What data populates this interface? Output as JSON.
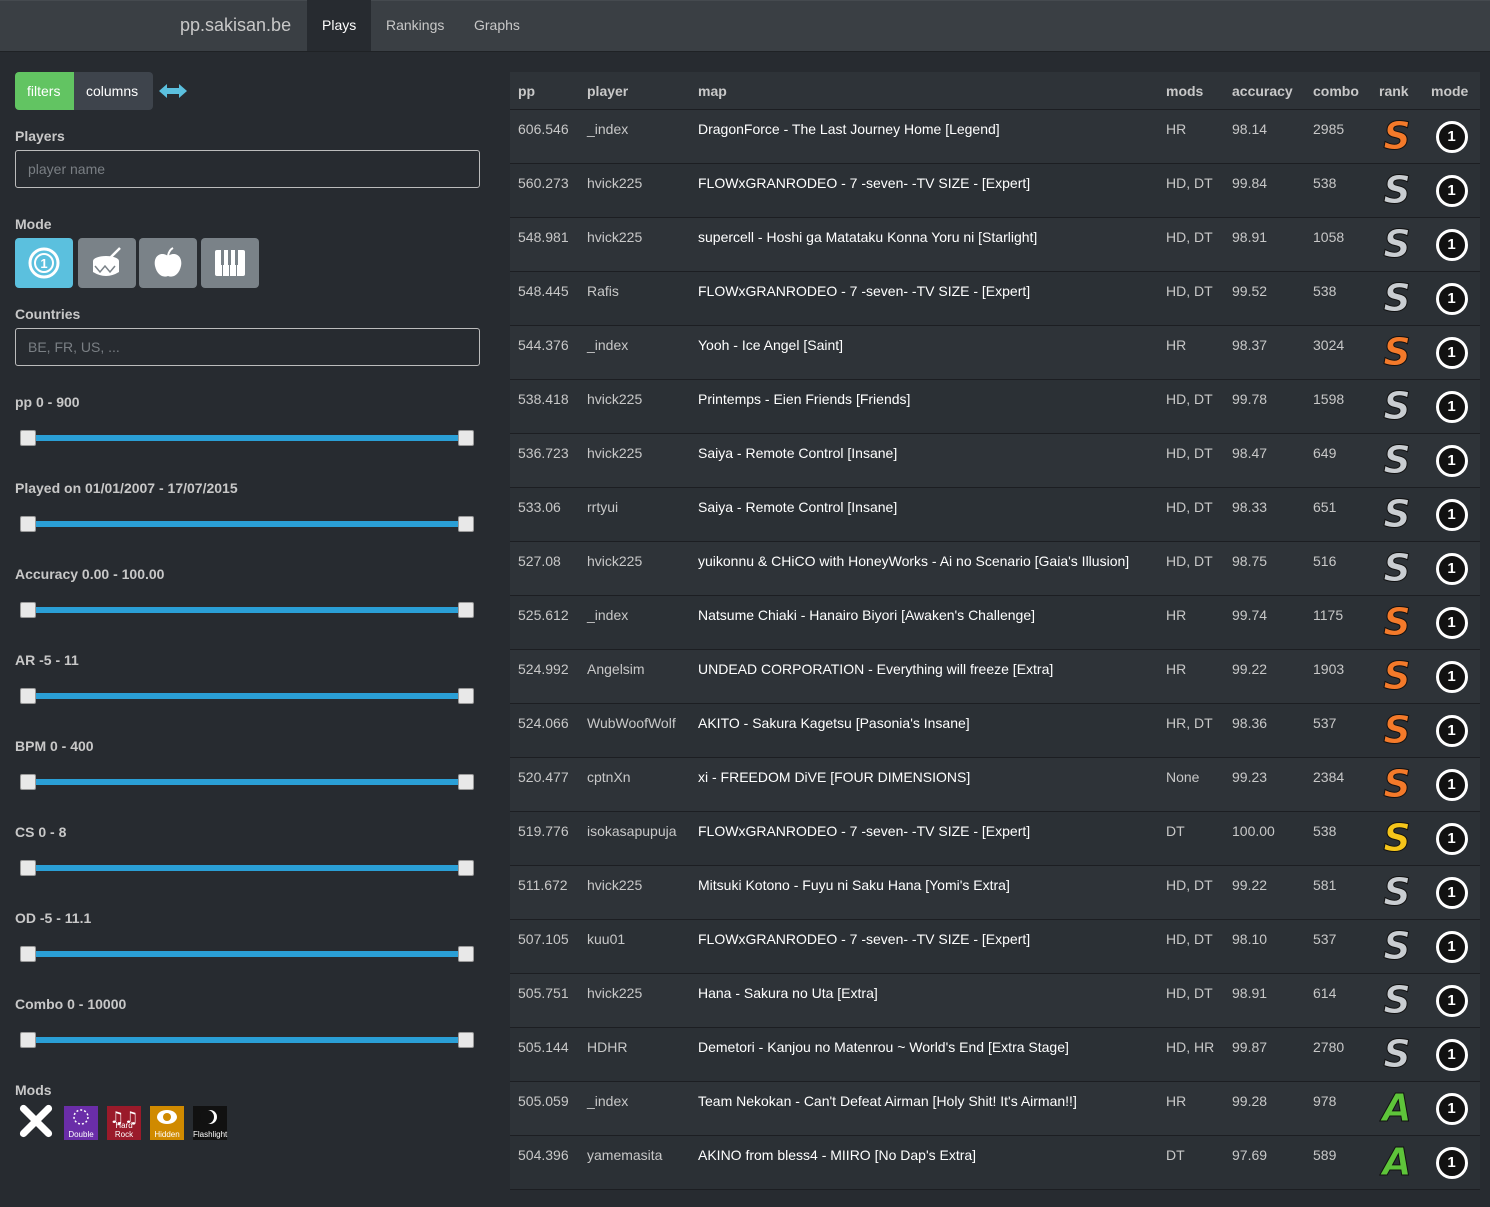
{
  "nav": {
    "brand": "pp.sakisan.be",
    "tabs": [
      "Plays",
      "Rankings",
      "Graphs"
    ]
  },
  "sidebar": {
    "filters_label": "filters",
    "columns_label": "columns",
    "players_label": "Players",
    "player_placeholder": "player name",
    "mode_label": "Mode",
    "modes": [
      {
        "name": "osu",
        "active": true
      },
      {
        "name": "taiko",
        "active": false
      },
      {
        "name": "catch",
        "active": false
      },
      {
        "name": "mania",
        "active": false
      }
    ],
    "countries_label": "Countries",
    "countries_placeholder": "BE, FR, US, ...",
    "sliders": [
      "pp 0 - 900",
      "Played on 01/01/2007 - 17/07/2015",
      "Accuracy 0.00 - 100.00",
      "AR -5 - 11",
      "BPM 0 - 400",
      "CS 0 - 8",
      "OD -5 - 11.1",
      "Combo 0 - 10000"
    ],
    "mods_label": "Mods",
    "mods": [
      "Double",
      "Hard Rock",
      "Hidden",
      "Flashlight"
    ]
  },
  "table": {
    "headers": [
      "pp",
      "player",
      "map",
      "mods",
      "accuracy",
      "combo",
      "rank",
      "mode"
    ],
    "rows": [
      {
        "pp": "606.546",
        "player": "_index",
        "map": "DragonForce - The Last Journey Home [Legend]",
        "mods": "HR",
        "accuracy": "98.14",
        "combo": "2985",
        "rank": "S",
        "rank_color": "#f47a2a",
        "mode": "1"
      },
      {
        "pp": "560.273",
        "player": "hvick225",
        "map": "FLOWxGRANRODEO - 7 -seven- -TV SIZE - [Expert]",
        "mods": "HD, DT",
        "accuracy": "99.84",
        "combo": "538",
        "rank": "S",
        "rank_color": "#c9cdd1",
        "mode": "1"
      },
      {
        "pp": "548.981",
        "player": "hvick225",
        "map": "supercell - Hoshi ga Matataku Konna Yoru ni [Starlight]",
        "mods": "HD, DT",
        "accuracy": "98.91",
        "combo": "1058",
        "rank": "S",
        "rank_color": "#c9cdd1",
        "mode": "1"
      },
      {
        "pp": "548.445",
        "player": "Rafis",
        "map": "FLOWxGRANRODEO - 7 -seven- -TV SIZE - [Expert]",
        "mods": "HD, DT",
        "accuracy": "99.52",
        "combo": "538",
        "rank": "S",
        "rank_color": "#c9cdd1",
        "mode": "1"
      },
      {
        "pp": "544.376",
        "player": "_index",
        "map": "Yooh - Ice Angel [Saint]",
        "mods": "HR",
        "accuracy": "98.37",
        "combo": "3024",
        "rank": "S",
        "rank_color": "#f47a2a",
        "mode": "1"
      },
      {
        "pp": "538.418",
        "player": "hvick225",
        "map": "Printemps - Eien Friends [Friends]",
        "mods": "HD, DT",
        "accuracy": "99.78",
        "combo": "1598",
        "rank": "S",
        "rank_color": "#c9cdd1",
        "mode": "1"
      },
      {
        "pp": "536.723",
        "player": "hvick225",
        "map": "Saiya - Remote Control [Insane]",
        "mods": "HD, DT",
        "accuracy": "98.47",
        "combo": "649",
        "rank": "S",
        "rank_color": "#c9cdd1",
        "mode": "1"
      },
      {
        "pp": "533.06",
        "player": "rrtyui",
        "map": "Saiya - Remote Control [Insane]",
        "mods": "HD, DT",
        "accuracy": "98.33",
        "combo": "651",
        "rank": "S",
        "rank_color": "#c9cdd1",
        "mode": "1"
      },
      {
        "pp": "527.08",
        "player": "hvick225",
        "map": "yuikonnu & CHiCO with HoneyWorks - Ai no Scenario [Gaia's Illusion]",
        "mods": "HD, DT",
        "accuracy": "98.75",
        "combo": "516",
        "rank": "S",
        "rank_color": "#c9cdd1",
        "mode": "1"
      },
      {
        "pp": "525.612",
        "player": "_index",
        "map": "Natsume Chiaki - Hanairo Biyori [Awaken's Challenge]",
        "mods": "HR",
        "accuracy": "99.74",
        "combo": "1175",
        "rank": "S",
        "rank_color": "#f47a2a",
        "mode": "1"
      },
      {
        "pp": "524.992",
        "player": "Angelsim",
        "map": "UNDEAD CORPORATION - Everything will freeze [Extra]",
        "mods": "HR",
        "accuracy": "99.22",
        "combo": "1903",
        "rank": "S",
        "rank_color": "#f47a2a",
        "mode": "1"
      },
      {
        "pp": "524.066",
        "player": "WubWoofWolf",
        "map": "AKITO - Sakura Kagetsu [Pasonia's Insane]",
        "mods": "HR, DT",
        "accuracy": "98.36",
        "combo": "537",
        "rank": "S",
        "rank_color": "#f47a2a",
        "mode": "1"
      },
      {
        "pp": "520.477",
        "player": "cptnXn",
        "map": "xi - FREEDOM DiVE [FOUR DIMENSIONS]",
        "mods": "None",
        "accuracy": "99.23",
        "combo": "2384",
        "rank": "S",
        "rank_color": "#f47a2a",
        "mode": "1"
      },
      {
        "pp": "519.776",
        "player": "isokasapupuja",
        "map": "FLOWxGRANRODEO - 7 -seven- -TV SIZE - [Expert]",
        "mods": "DT",
        "accuracy": "100.00",
        "combo": "538",
        "rank": "S",
        "rank_color": "#f5c51a",
        "mode": "1"
      },
      {
        "pp": "511.672",
        "player": "hvick225",
        "map": "Mitsuki Kotono - Fuyu ni Saku Hana [Yomi's Extra]",
        "mods": "HD, DT",
        "accuracy": "99.22",
        "combo": "581",
        "rank": "S",
        "rank_color": "#c9cdd1",
        "mode": "1"
      },
      {
        "pp": "507.105",
        "player": "kuu01",
        "map": "FLOWxGRANRODEO - 7 -seven- -TV SIZE - [Expert]",
        "mods": "HD, DT",
        "accuracy": "98.10",
        "combo": "537",
        "rank": "S",
        "rank_color": "#c9cdd1",
        "mode": "1"
      },
      {
        "pp": "505.751",
        "player": "hvick225",
        "map": "Hana - Sakura no Uta [Extra]",
        "mods": "HD, DT",
        "accuracy": "98.91",
        "combo": "614",
        "rank": "S",
        "rank_color": "#c9cdd1",
        "mode": "1"
      },
      {
        "pp": "505.144",
        "player": "HDHR",
        "map": "Demetori - Kanjou no Matenrou ~ World's End [Extra Stage]",
        "mods": "HD, HR",
        "accuracy": "99.87",
        "combo": "2780",
        "rank": "S",
        "rank_color": "#c9cdd1",
        "mode": "1"
      },
      {
        "pp": "505.059",
        "player": "_index",
        "map": "Team Nekokan - Can't Defeat Airman [Holy Shit! It's Airman!!]",
        "mods": "HR",
        "accuracy": "99.28",
        "combo": "978",
        "rank": "A",
        "rank_color": "#5ec43a",
        "mode": "1"
      },
      {
        "pp": "504.396",
        "player": "yamemasita",
        "map": "AKINO from bless4 - MIIRO [No Dap's Extra]",
        "mods": "DT",
        "accuracy": "97.69",
        "combo": "589",
        "rank": "A",
        "rank_color": "#5ec43a",
        "mode": "1"
      }
    ]
  },
  "colors": {
    "accent": "#2a9fd6",
    "success": "#62c462",
    "info": "#5bc0de"
  }
}
